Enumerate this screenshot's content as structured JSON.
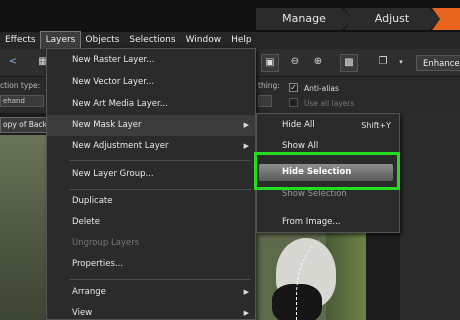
{
  "workspace_tabs": {
    "manage": "Manage",
    "adjust": "Adjust"
  },
  "menubar": [
    "Effects",
    "Layers",
    "Objects",
    "Selections",
    "Window",
    "Help"
  ],
  "toolbar": {
    "enhance": "Enhance"
  },
  "options": {
    "selection_type_label": "ction type:",
    "selection_type_value": "ehand",
    "smoothing_label": "thing:",
    "anti_alias": "Anti-alias",
    "use_all_layers": "Use all layers"
  },
  "document_tab": "opy of Backg",
  "layers_menu": {
    "items": [
      "New Raster Layer...",
      "New Vector Layer...",
      "New Art Media Layer...",
      "New Mask Layer",
      "New Adjustment Layer",
      "New Layer Group...",
      "Duplicate",
      "Delete",
      "Ungroup Layers",
      "Properties...",
      "Arrange",
      "View"
    ]
  },
  "mask_menu": {
    "hide_all": "Hide All",
    "hide_all_shortcut": "Shift+Y",
    "show_all": "Show All",
    "hide_selection": "Hide Selection",
    "show_selection": "Show Selection",
    "from_image": "From Image..."
  },
  "highlight_color": "#22dd22",
  "accent_color": "#e8641f"
}
